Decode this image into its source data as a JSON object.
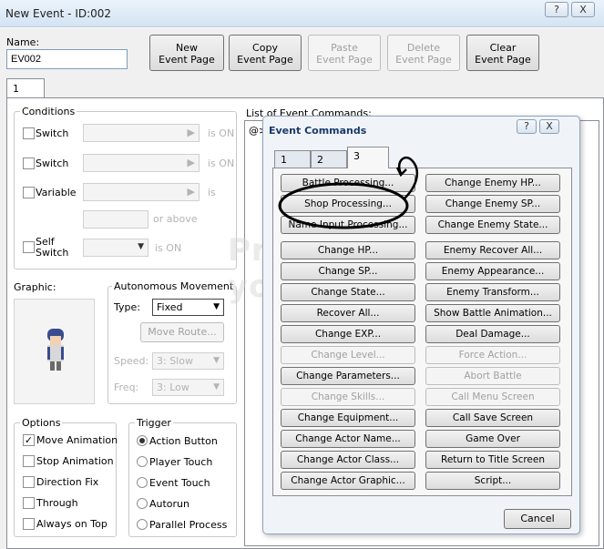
{
  "window": {
    "title": "New Event - ID:002",
    "help": "?",
    "close": "X"
  },
  "name_label": "Name:",
  "name_value": "EV002",
  "toolbar": {
    "new": "New\nEvent Page",
    "copy": "Copy\nEvent Page",
    "paste": "Paste\nEvent Page",
    "delete": "Delete\nEvent Page",
    "clear": "Clear\nEvent Page"
  },
  "page_tab": "1",
  "conditions": {
    "title": "Conditions",
    "switch1": "Switch",
    "switch2": "Switch",
    "variable": "Variable",
    "self_switch": "Self\nSwitch",
    "is_on1": "is ON",
    "is_on2": "is ON",
    "is": "is",
    "or_above": "or above",
    "is_on3": "is ON"
  },
  "graphic_label": "Graphic:",
  "movement": {
    "title": "Autonomous Movement",
    "type_label": "Type:",
    "type_value": "Fixed",
    "move_route": "Move Route...",
    "speed_label": "Speed:",
    "speed_value": "3: Slow",
    "freq_label": "Freq:",
    "freq_value": "3: Low"
  },
  "options": {
    "title": "Options",
    "items": [
      "Move Animation",
      "Stop Animation",
      "Direction Fix",
      "Through",
      "Always on Top"
    ],
    "checked": [
      true,
      false,
      false,
      false,
      false
    ]
  },
  "trigger": {
    "title": "Trigger",
    "items": [
      "Action Button",
      "Player Touch",
      "Event Touch",
      "Autorun",
      "Parallel Process"
    ],
    "selected": 0
  },
  "list_label": "List of Event Commands:",
  "list_first": "@>",
  "dialog": {
    "title": "Event Commands",
    "help": "?",
    "close": "X",
    "tabs": [
      "1",
      "2",
      "3"
    ],
    "active_tab": 2,
    "cancel": "Cancel",
    "left": [
      {
        "l": "Battle Processing...",
        "d": false
      },
      {
        "l": "Shop Processing...",
        "d": false
      },
      {
        "l": "Name Input Processing...",
        "d": false
      },
      {
        "l": "Change HP...",
        "d": false
      },
      {
        "l": "Change SP...",
        "d": false
      },
      {
        "l": "Change State...",
        "d": false
      },
      {
        "l": "Recover All...",
        "d": false
      },
      {
        "l": "Change EXP...",
        "d": false
      },
      {
        "l": "Change Level...",
        "d": true
      },
      {
        "l": "Change Parameters...",
        "d": false
      },
      {
        "l": "Change Skills...",
        "d": true
      },
      {
        "l": "Change Equipment...",
        "d": false
      },
      {
        "l": "Change Actor Name...",
        "d": false
      },
      {
        "l": "Change Actor Class...",
        "d": false
      },
      {
        "l": "Change Actor Graphic...",
        "d": false
      }
    ],
    "right": [
      {
        "l": "Change Enemy HP...",
        "d": false
      },
      {
        "l": "Change Enemy SP...",
        "d": false
      },
      {
        "l": "Change Enemy State...",
        "d": false
      },
      {
        "l": "Enemy Recover All...",
        "d": false
      },
      {
        "l": "Enemy Appearance...",
        "d": false
      },
      {
        "l": "Enemy Transform...",
        "d": false
      },
      {
        "l": "Show Battle Animation...",
        "d": false
      },
      {
        "l": "Deal Damage...",
        "d": false
      },
      {
        "l": "Force Action...",
        "d": true
      },
      {
        "l": "Abort Battle",
        "d": true
      },
      {
        "l": "Call Menu Screen",
        "d": true
      },
      {
        "l": "Call Save Screen",
        "d": false
      },
      {
        "l": "Game Over",
        "d": false
      },
      {
        "l": "Return to Title Screen",
        "d": false
      },
      {
        "l": "Script...",
        "d": false
      }
    ]
  },
  "colors": {
    "highlight_ring": "#000000",
    "tab_blue": "#a8c8ea"
  }
}
